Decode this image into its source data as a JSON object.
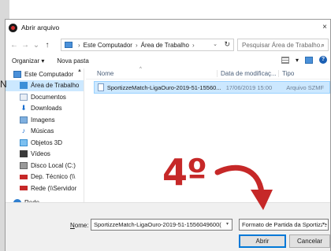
{
  "dialog": {
    "title": "Abrir arquivo",
    "close": "×"
  },
  "background": {
    "behind_text": "N"
  },
  "address_bar": {
    "back": "←",
    "forward": "→",
    "dropdown": "⌄",
    "up": "↑",
    "path_parts": [
      "Este Computador",
      "Área de Trabalho"
    ],
    "path_separator": "›",
    "path_dropdown": "⌄",
    "refresh": "↻",
    "search_placeholder": "Pesquisar Área de Trabalho",
    "search_icon": "⌕"
  },
  "toolbar": {
    "organize": "Organizar ▾",
    "new_folder": "Nova pasta",
    "view_dropdown": "▾",
    "help": "?"
  },
  "sidebar": {
    "scroll_up": "▲",
    "scroll_down": "▼",
    "items": [
      {
        "label": "Este Computador",
        "icon": "computer-icon",
        "selected": false
      },
      {
        "label": "Área de Trabalho",
        "icon": "desktop-icon",
        "selected": true
      },
      {
        "label": "Documentos",
        "icon": "documents-icon",
        "selected": false
      },
      {
        "label": "Downloads",
        "icon": "downloads-icon",
        "selected": false
      },
      {
        "label": "Imagens",
        "icon": "images-icon",
        "selected": false
      },
      {
        "label": "Músicas",
        "icon": "music-icon",
        "selected": false
      },
      {
        "label": "Objetos 3D",
        "icon": "objects-3d-icon",
        "selected": false
      },
      {
        "label": "Vídeos",
        "icon": "videos-icon",
        "selected": false
      },
      {
        "label": "Disco Local (C:)",
        "icon": "disk-icon",
        "selected": false
      },
      {
        "label": "Dep. Técnico (\\\\",
        "icon": "network-drive-icon",
        "selected": false
      },
      {
        "label": "Rede (\\\\Servidor",
        "icon": "network-drive-icon",
        "selected": false
      },
      {
        "label": "Rede",
        "icon": "network-icon",
        "selected": false
      }
    ]
  },
  "file_list": {
    "columns": [
      "Nome",
      "Data de modificaç...",
      "Tipo"
    ],
    "sort_indicator": "^",
    "rows": [
      {
        "name": "SportizzeMatch-LigaOuro-2019-51-15560...",
        "date": "17/06/2019 15:00",
        "type": "Arquivo SZMF"
      }
    ]
  },
  "hscroll": {
    "left_arrow": "‹"
  },
  "bottom": {
    "name_label_prefix": "N",
    "name_label_rest": "ome:",
    "name_value": "SportizzeMatch-LigaOuro-2019-51-1556049600(",
    "name_dropdown": "▾",
    "filter_value": "Formato de Partida da Sportizze",
    "filter_dropdown": "▾",
    "open_button": "Abrir",
    "cancel_button": "Cancelar"
  },
  "annotation": {
    "step": "4º",
    "color": "#c62828"
  },
  "colors": {
    "selection": "#cce8ff",
    "accent": "#0078d7"
  }
}
